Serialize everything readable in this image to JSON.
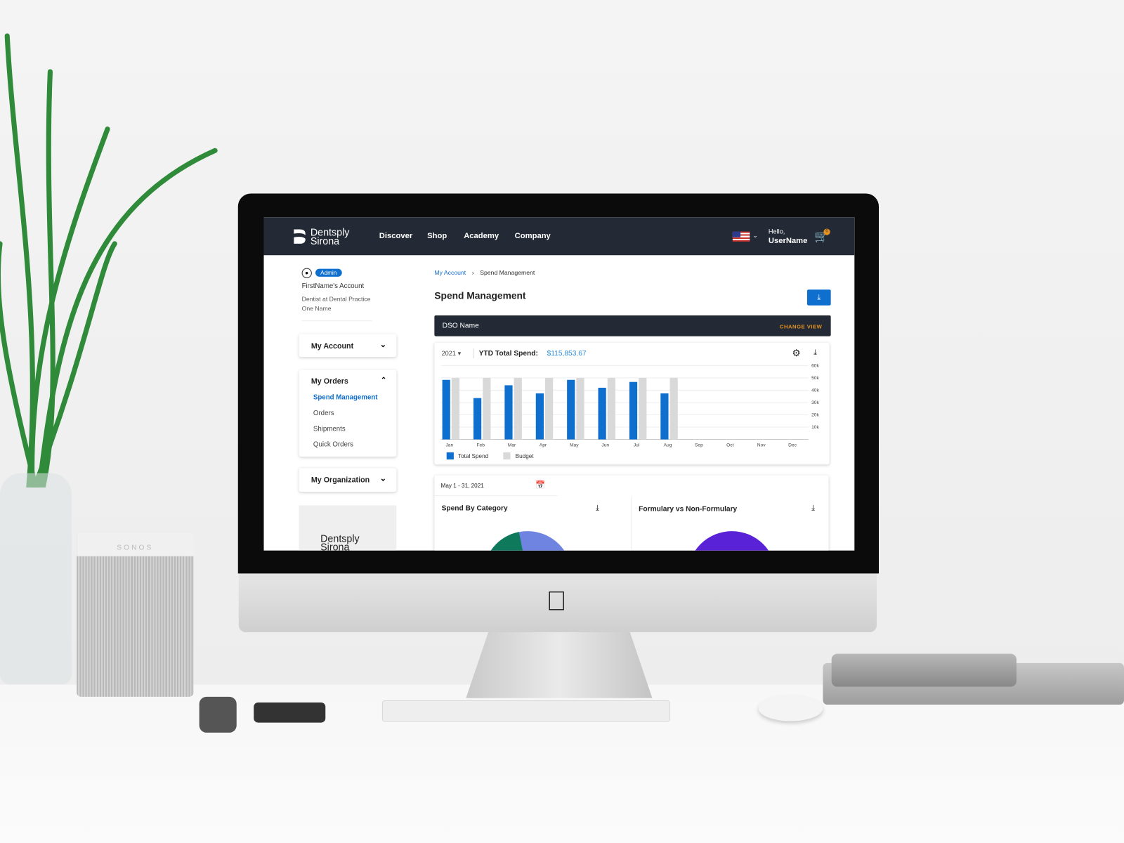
{
  "nav": {
    "brand": [
      "Dentsply",
      "Sirona"
    ],
    "items": [
      "Discover",
      "Shop",
      "Academy",
      "Company"
    ],
    "greeting": "Hello,",
    "username": "UserName",
    "cart_count": "0",
    "locale_flag": "us-flag-icon"
  },
  "account": {
    "badge": "Admin",
    "name": "FirstName's Account",
    "role": "Dentist at Dental Practice",
    "practice": "One Name"
  },
  "sidebar": {
    "sections": [
      {
        "label": "My Account",
        "expanded": false
      },
      {
        "label": "My Orders",
        "expanded": true,
        "items": [
          "Spend Management",
          "Orders",
          "Shipments",
          "Quick Orders"
        ],
        "active": "Spend Management"
      },
      {
        "label": "My Organization",
        "expanded": false
      }
    ],
    "promo_brand": [
      "Dentsply",
      "Sirona"
    ]
  },
  "main": {
    "breadcrumb": [
      "My Account",
      "Spend Management"
    ],
    "title": "Spend Management",
    "dso_name": "DSO Name",
    "change_view": "CHANGE VIEW",
    "year": "2021",
    "ytd_label": "YTD Total Spend:",
    "ytd_value": "$115,853.67",
    "date_range": "May 1 - 31, 2021",
    "panels": [
      "Spend By Category",
      "Formulary vs Non-Formulary"
    ]
  },
  "colors": {
    "nav": "#232a35",
    "accent": "#0f6fcf",
    "budget": "#d9d9d9",
    "orange": "#e8931e"
  },
  "chart_data": {
    "type": "bar",
    "categories": [
      "Jan",
      "Feb",
      "Mar",
      "Apr",
      "May",
      "Jun",
      "Jul",
      "Aug",
      "Sep",
      "Oct",
      "Nov",
      "Dec"
    ],
    "series": [
      {
        "name": "Total Spend",
        "color": "#0f6fcf",
        "values": [
          48400,
          33600,
          44000,
          37400,
          48400,
          42000,
          46700,
          37400,
          null,
          null,
          null,
          null
        ]
      },
      {
        "name": "Budget",
        "color": "#d9d9d9",
        "values": [
          50000,
          50000,
          50000,
          50000,
          50000,
          50000,
          50000,
          50000,
          null,
          null,
          null,
          null
        ]
      }
    ],
    "yticks": [
      "10k",
      "20k",
      "30k",
      "40k",
      "50k",
      "60k"
    ],
    "ylim": [
      0,
      60000
    ],
    "grid": true,
    "legend": "bottom-left"
  }
}
